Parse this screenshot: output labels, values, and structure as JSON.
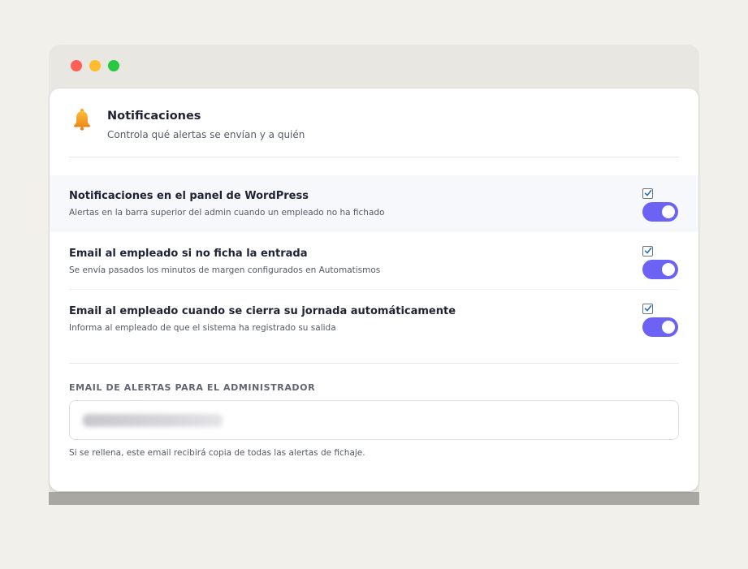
{
  "window": {
    "controls": [
      "close",
      "minimize",
      "maximize"
    ]
  },
  "header": {
    "icon": "bell-icon",
    "title": "Notificaciones",
    "subtitle": "Controla qué alertas se envían y a quién"
  },
  "settings": [
    {
      "title": "Notificaciones en el panel de WordPress",
      "description": "Alertas en la barra superior del admin cuando un empleado no ha fichado",
      "checked": true,
      "enabled": true
    },
    {
      "title": "Email al empleado si no ficha la entrada",
      "description": "Se envía pasados los minutos de margen configurados en Automatismos",
      "checked": true,
      "enabled": true
    },
    {
      "title": "Email al empleado cuando se cierra su jornada automáticamente",
      "description": "Informa al empleado de que el sistema ha registrado su salida",
      "checked": true,
      "enabled": true
    }
  ],
  "admin_email": {
    "label": "EMAIL DE ALERTAS PARA EL ADMINISTRADOR",
    "hint": "Si se rellena, este email recibirá copia de todas las alertas de fichaje."
  },
  "colors": {
    "accent": "#6c63f5",
    "close": "#fe5f57",
    "minimize": "#febc2e",
    "maximize": "#28c840",
    "bell": "#f5a623"
  }
}
